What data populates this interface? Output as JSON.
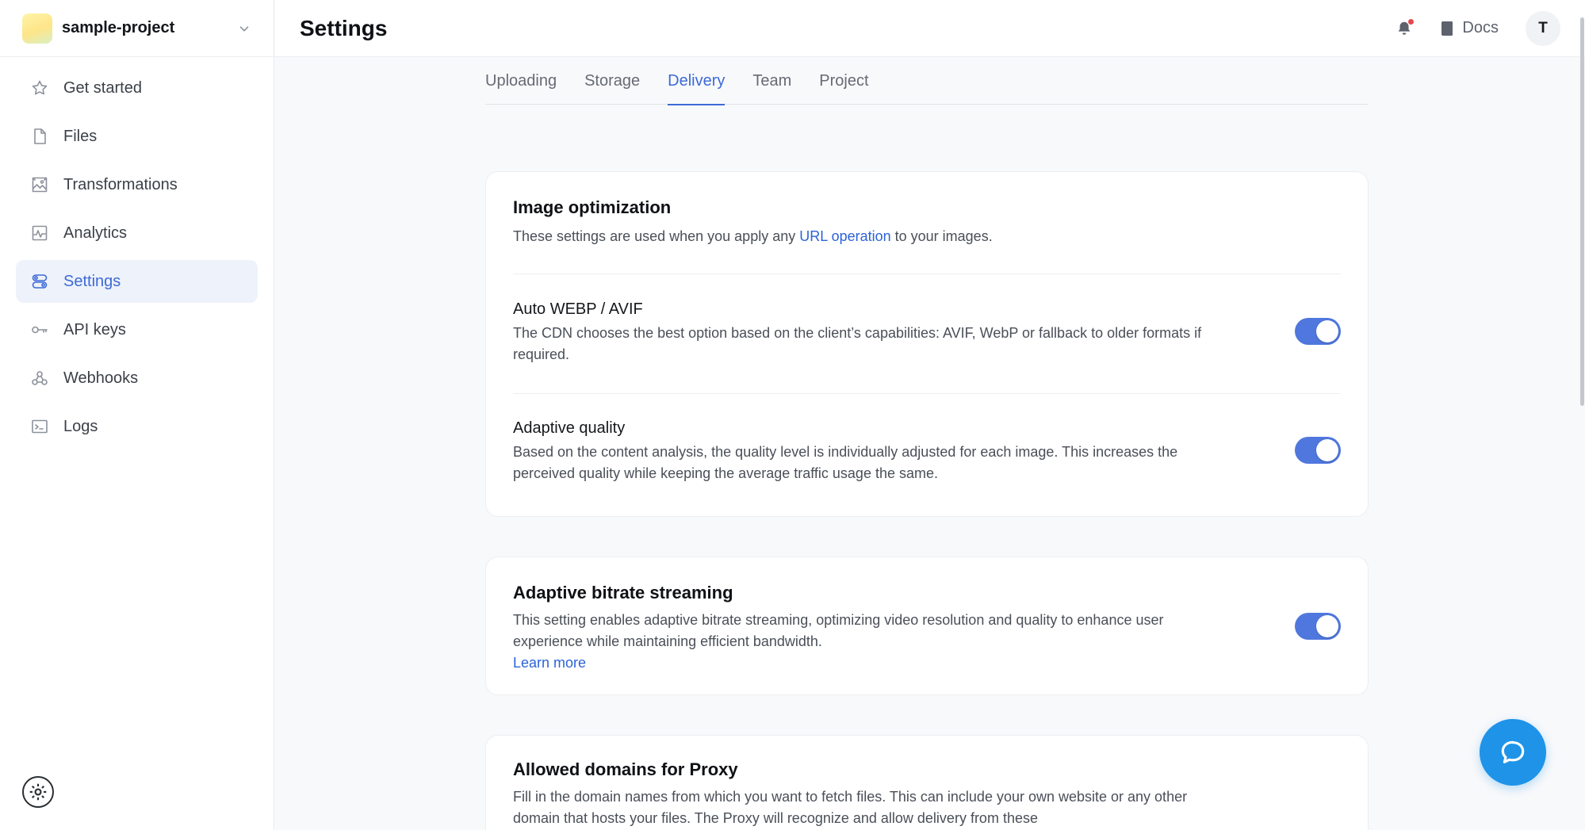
{
  "sidebar": {
    "project_name": "sample-project",
    "items": [
      {
        "label": "Get started",
        "icon": "star-icon"
      },
      {
        "label": "Files",
        "icon": "file-icon"
      },
      {
        "label": "Transformations",
        "icon": "image-transform-icon"
      },
      {
        "label": "Analytics",
        "icon": "analytics-icon"
      },
      {
        "label": "Settings",
        "icon": "settings-toggle-icon",
        "active": true
      },
      {
        "label": "API keys",
        "icon": "key-icon"
      },
      {
        "label": "Webhooks",
        "icon": "webhook-icon"
      },
      {
        "label": "Logs",
        "icon": "terminal-icon"
      }
    ]
  },
  "header": {
    "title": "Settings",
    "docs_label": "Docs",
    "avatar_initial": "T"
  },
  "tabs": [
    {
      "label": "Uploading"
    },
    {
      "label": "Storage"
    },
    {
      "label": "Delivery",
      "active": true
    },
    {
      "label": "Team"
    },
    {
      "label": "Project"
    }
  ],
  "image_optimization": {
    "title": "Image optimization",
    "desc_before": "These settings are used when you apply any ",
    "desc_link": "URL operation",
    "desc_after": " to your images.",
    "auto_webp": {
      "title": "Auto WEBP / AVIF",
      "desc": "The CDN chooses the best option based on the client’s capabilities: AVIF, WebP or fallback to older formats if required.",
      "enabled": true
    },
    "adaptive_quality": {
      "title": "Adaptive quality",
      "desc": "Based on the content analysis, the quality level is individually adjusted for each image. This increases the perceived quality while keeping the average traffic usage the same.",
      "enabled": true
    }
  },
  "adaptive_bitrate": {
    "title": "Adaptive bitrate streaming",
    "desc": "This setting enables adaptive bitrate streaming, optimizing video resolution and quality to enhance user experience while maintaining efficient bandwidth.",
    "link": "Learn more",
    "enabled": true
  },
  "proxy": {
    "title": "Allowed domains for Proxy",
    "desc": "Fill in the domain names from which you want to fetch files. This can include your own website or any other domain that hosts your files. The Proxy will recognize and allow delivery from these"
  },
  "colors": {
    "accent": "#3d6ad6",
    "toggle_on": "#4f77de",
    "chat_button": "#1e93e8"
  }
}
